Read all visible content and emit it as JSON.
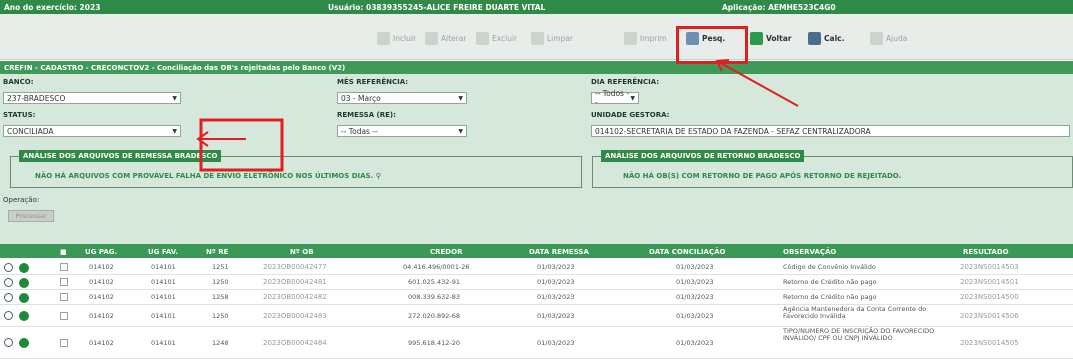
{
  "topbar": {
    "year": "Ano do exercício: 2023",
    "user": "Usuário: 03839355245-ALICE FREIRE DUARTE VITAL",
    "app": "Aplicação: AEMHE523C4G0"
  },
  "toolbar": {
    "incluir": "Incluir",
    "alterar": "Alterar",
    "excluir": "Excluir",
    "limpar": "Limpar",
    "imprimir": "Imprim",
    "pesquisar": "Pesq.",
    "voltar": "Voltar",
    "calc": "Calc.",
    "ajuda": "Ajuda"
  },
  "breadcrumb": "CREFIN - CADASTRO - CRECONCTOV2 - Conciliação das OB's rejeitadas pelo Banco (V2)",
  "form": {
    "banco_label": "BANCO:",
    "banco_value": "237-BRADESCO",
    "mes_label": "MÊS REFERÊNCIA:",
    "mes_value": "03 - Março",
    "dia_label": "DIA REFERÊNCIA:",
    "dia_value": "-- Todos --",
    "status_label": "STATUS:",
    "status_value": "CONCILIADA",
    "remessa_label": "REMESSA (RE):",
    "remessa_value": "-- Todas --",
    "gestora_label": "UNIDADE GESTORA:",
    "gestora_value": "014102-SECRETARIA DE ESTADO DA FAZENDA - SEFAZ CENTRALIZADORA"
  },
  "panels": {
    "remessa_title": "ANÁLISE DOS ARQUIVOS DE REMESSA BRADESCO",
    "remessa_msg": "NÃO HÁ ARQUIVOS COM PROVÁVEL FALHA DE ENVIO ELETRÔNICO NOS ÚLTIMOS DIAS.",
    "retorno_title": "ANÁLISE DOS ARQUIVOS DE RETORNO BRADESCO",
    "retorno_msg": "NÃO HÁ OB(S) COM RETORNO DE PAGO APÓS RETORNO DE REJEITADO."
  },
  "operation": {
    "label": "Operação:",
    "button": "Processar"
  },
  "grid": {
    "headers": [
      "UG PAG.",
      "UG FAV.",
      "Nº RE",
      "Nº OB",
      "CREDOR",
      "DATA REMESSA",
      "DATA CONCILIAÇÃO",
      "OBSERVAÇÃO",
      "RESULTADO"
    ],
    "rows": [
      {
        "ug_pag": "014102",
        "ug_fav": "014101",
        "re": "1251",
        "ob": "2023OB00042477",
        "credor": "04.416.496/0001-26",
        "remessa": "01/03/2023",
        "conciliacao": "01/03/2023",
        "obs": "Código de Convênio Inválido",
        "resultado": "2023NS0014503"
      },
      {
        "ug_pag": "014102",
        "ug_fav": "014101",
        "re": "1250",
        "ob": "2023OB00042481",
        "credor": "601.025.432-91",
        "remessa": "01/03/2023",
        "conciliacao": "01/03/2023",
        "obs": "Retorno de Crédito não pago",
        "resultado": "2023NS0014501"
      },
      {
        "ug_pag": "014102",
        "ug_fav": "014101",
        "re": "1258",
        "ob": "2023OB00042482",
        "credor": "008.339.632-83",
        "remessa": "01/03/2023",
        "conciliacao": "01/03/2023",
        "obs": "Retorno de Crédito não pago",
        "resultado": "2023NS0014500"
      },
      {
        "ug_pag": "014102",
        "ug_fav": "014101",
        "re": "1250",
        "ob": "2023OB00042483",
        "credor": "272.020.892-68",
        "remessa": "01/03/2023",
        "conciliacao": "01/03/2023",
        "obs": "Agência Mantenedora da Conta Corrente do Favorecido Inválida",
        "resultado": "2023NS0014506"
      },
      {
        "ug_pag": "014102",
        "ug_fav": "014101",
        "re": "1248",
        "ob": "2023OB00042484",
        "credor": "995.618.412-20",
        "remessa": "01/03/2023",
        "conciliacao": "01/03/2023",
        "obs": "TIPO/NUMERO DE INSCRIÇÃO DO FAVORECIDO INVÁLIDO/ CPF OU CNPJ INVÁLIDO",
        "resultado": "2023NS0014505"
      }
    ]
  },
  "colors": {
    "header_green": "#2f8a47",
    "form_bg": "#d6e7db",
    "annotation_red": "#e02020"
  }
}
